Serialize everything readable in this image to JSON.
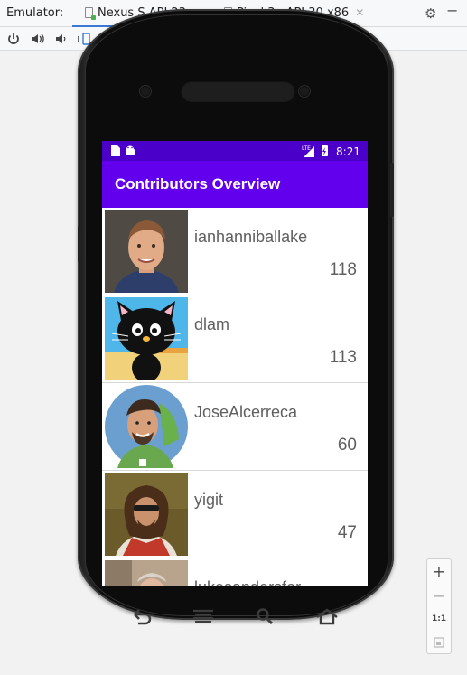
{
  "header": {
    "label": "Emulator:",
    "tabs": [
      {
        "label": "Nexus S API 23",
        "active": true
      },
      {
        "label": "Pixel 3a API 30 x86",
        "active": false
      }
    ]
  },
  "toolbar": {
    "icons": [
      "power-icon",
      "volume-up-icon",
      "volume-down-icon",
      "rotate-left-icon",
      "rotate-right-icon",
      "back-icon",
      "home-icon",
      "overview-icon",
      "camera-icon",
      "reset-icon"
    ]
  },
  "status_bar": {
    "time": "8:21",
    "network": "LTE"
  },
  "app": {
    "title": "Contributors Overview",
    "contributors": [
      {
        "login": "ianhanniballake",
        "contributions": "118"
      },
      {
        "login": "dlam",
        "contributions": "113"
      },
      {
        "login": "JoseAlcerreca",
        "contributions": "60"
      },
      {
        "login": "yigit",
        "contributions": "47"
      },
      {
        "login": "lukesandersfor",
        "contributions": ""
      }
    ]
  },
  "zoom": {
    "zoom_in": "+",
    "zoom_out": "−",
    "one_to_one": "1:1"
  },
  "colors": {
    "status_bar": "#4a00c8",
    "app_bar": "#6200ee",
    "accent_tab": "#3a78d4"
  }
}
